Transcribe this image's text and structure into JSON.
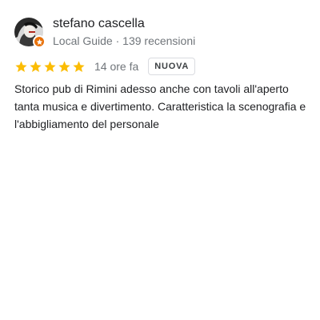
{
  "author": {
    "name": "stefano cascella",
    "meta": "Local Guide · 139 recensioni",
    "avatar_icon": "user-avatar",
    "badge_icon": "local-guide-star-icon"
  },
  "rating": {
    "stars": 5,
    "max": 5,
    "star_color": "#fbbc04",
    "time": "14 ore fa",
    "badge": "NUOVA"
  },
  "review": {
    "text": "Storico pub di Rimini adesso anche con tavoli all'aperto tanta musica e divertimento. Caratteristica la scenografia e l'abbigliamento del personale"
  },
  "colors": {
    "text_primary": "#202124",
    "text_secondary": "#70757a",
    "guide_badge": "#e8710a"
  }
}
